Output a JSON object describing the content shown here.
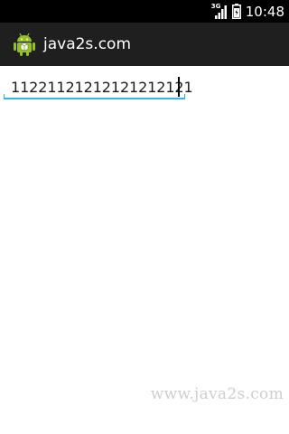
{
  "status_bar": {
    "network_type": "3G",
    "time": "10:48"
  },
  "action_bar": {
    "app_icon": "android-robot-icon",
    "title": "java2s.com"
  },
  "edit_text": {
    "value": "11221121212121212121"
  },
  "watermark": "www.java2s.com",
  "colors": {
    "status_bar": "#000000",
    "action_bar": "#1f1f1f",
    "accent_underline": "#33b5e5",
    "android_green": "#97c024"
  }
}
